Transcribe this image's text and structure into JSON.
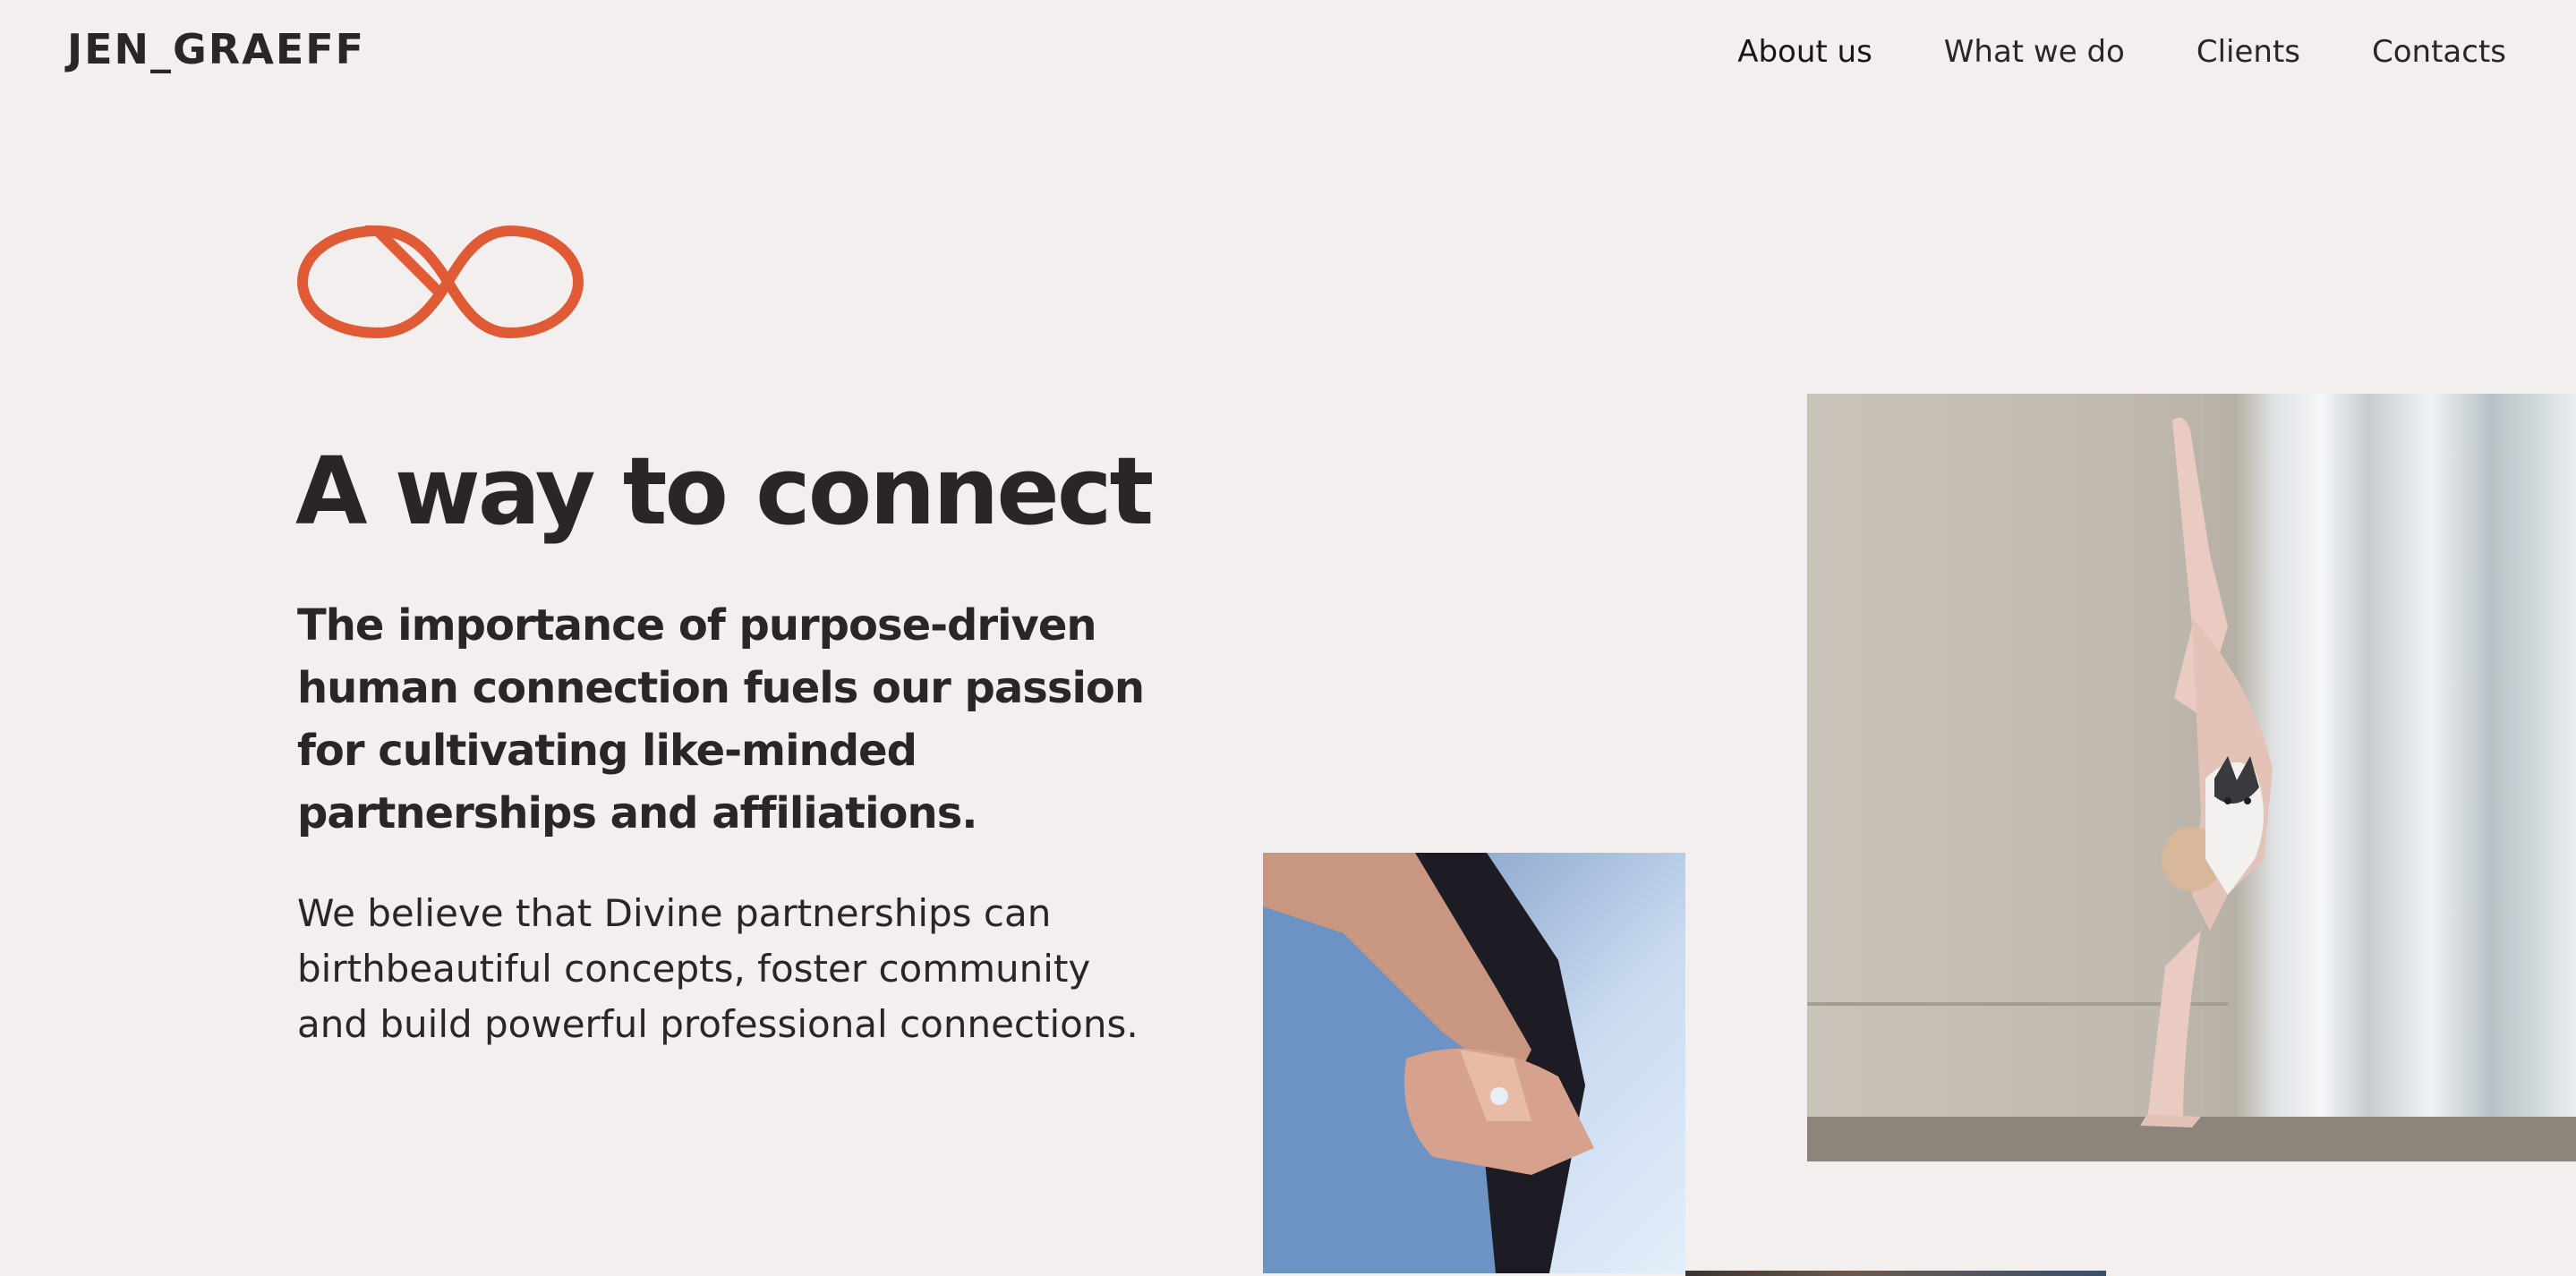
{
  "header": {
    "logo": "JEN_GRAEFF",
    "nav": [
      "About us",
      "What we do",
      "Clients",
      "Contacts"
    ]
  },
  "hero": {
    "icon": "infinity-icon",
    "accent_color": "#e05a36",
    "headline": "A way to connect",
    "subhead": "The importance of purpose-driven human connection fuels our passion for cultivating like-minded partnerships and affiliations.",
    "body": "We believe that Divine partnerships can birthbeautiful concepts, foster community and build powerful professional connections."
  },
  "images": {
    "acrobat": "acrobat-with-husky-photo",
    "hands": "holding-hands-photo"
  }
}
